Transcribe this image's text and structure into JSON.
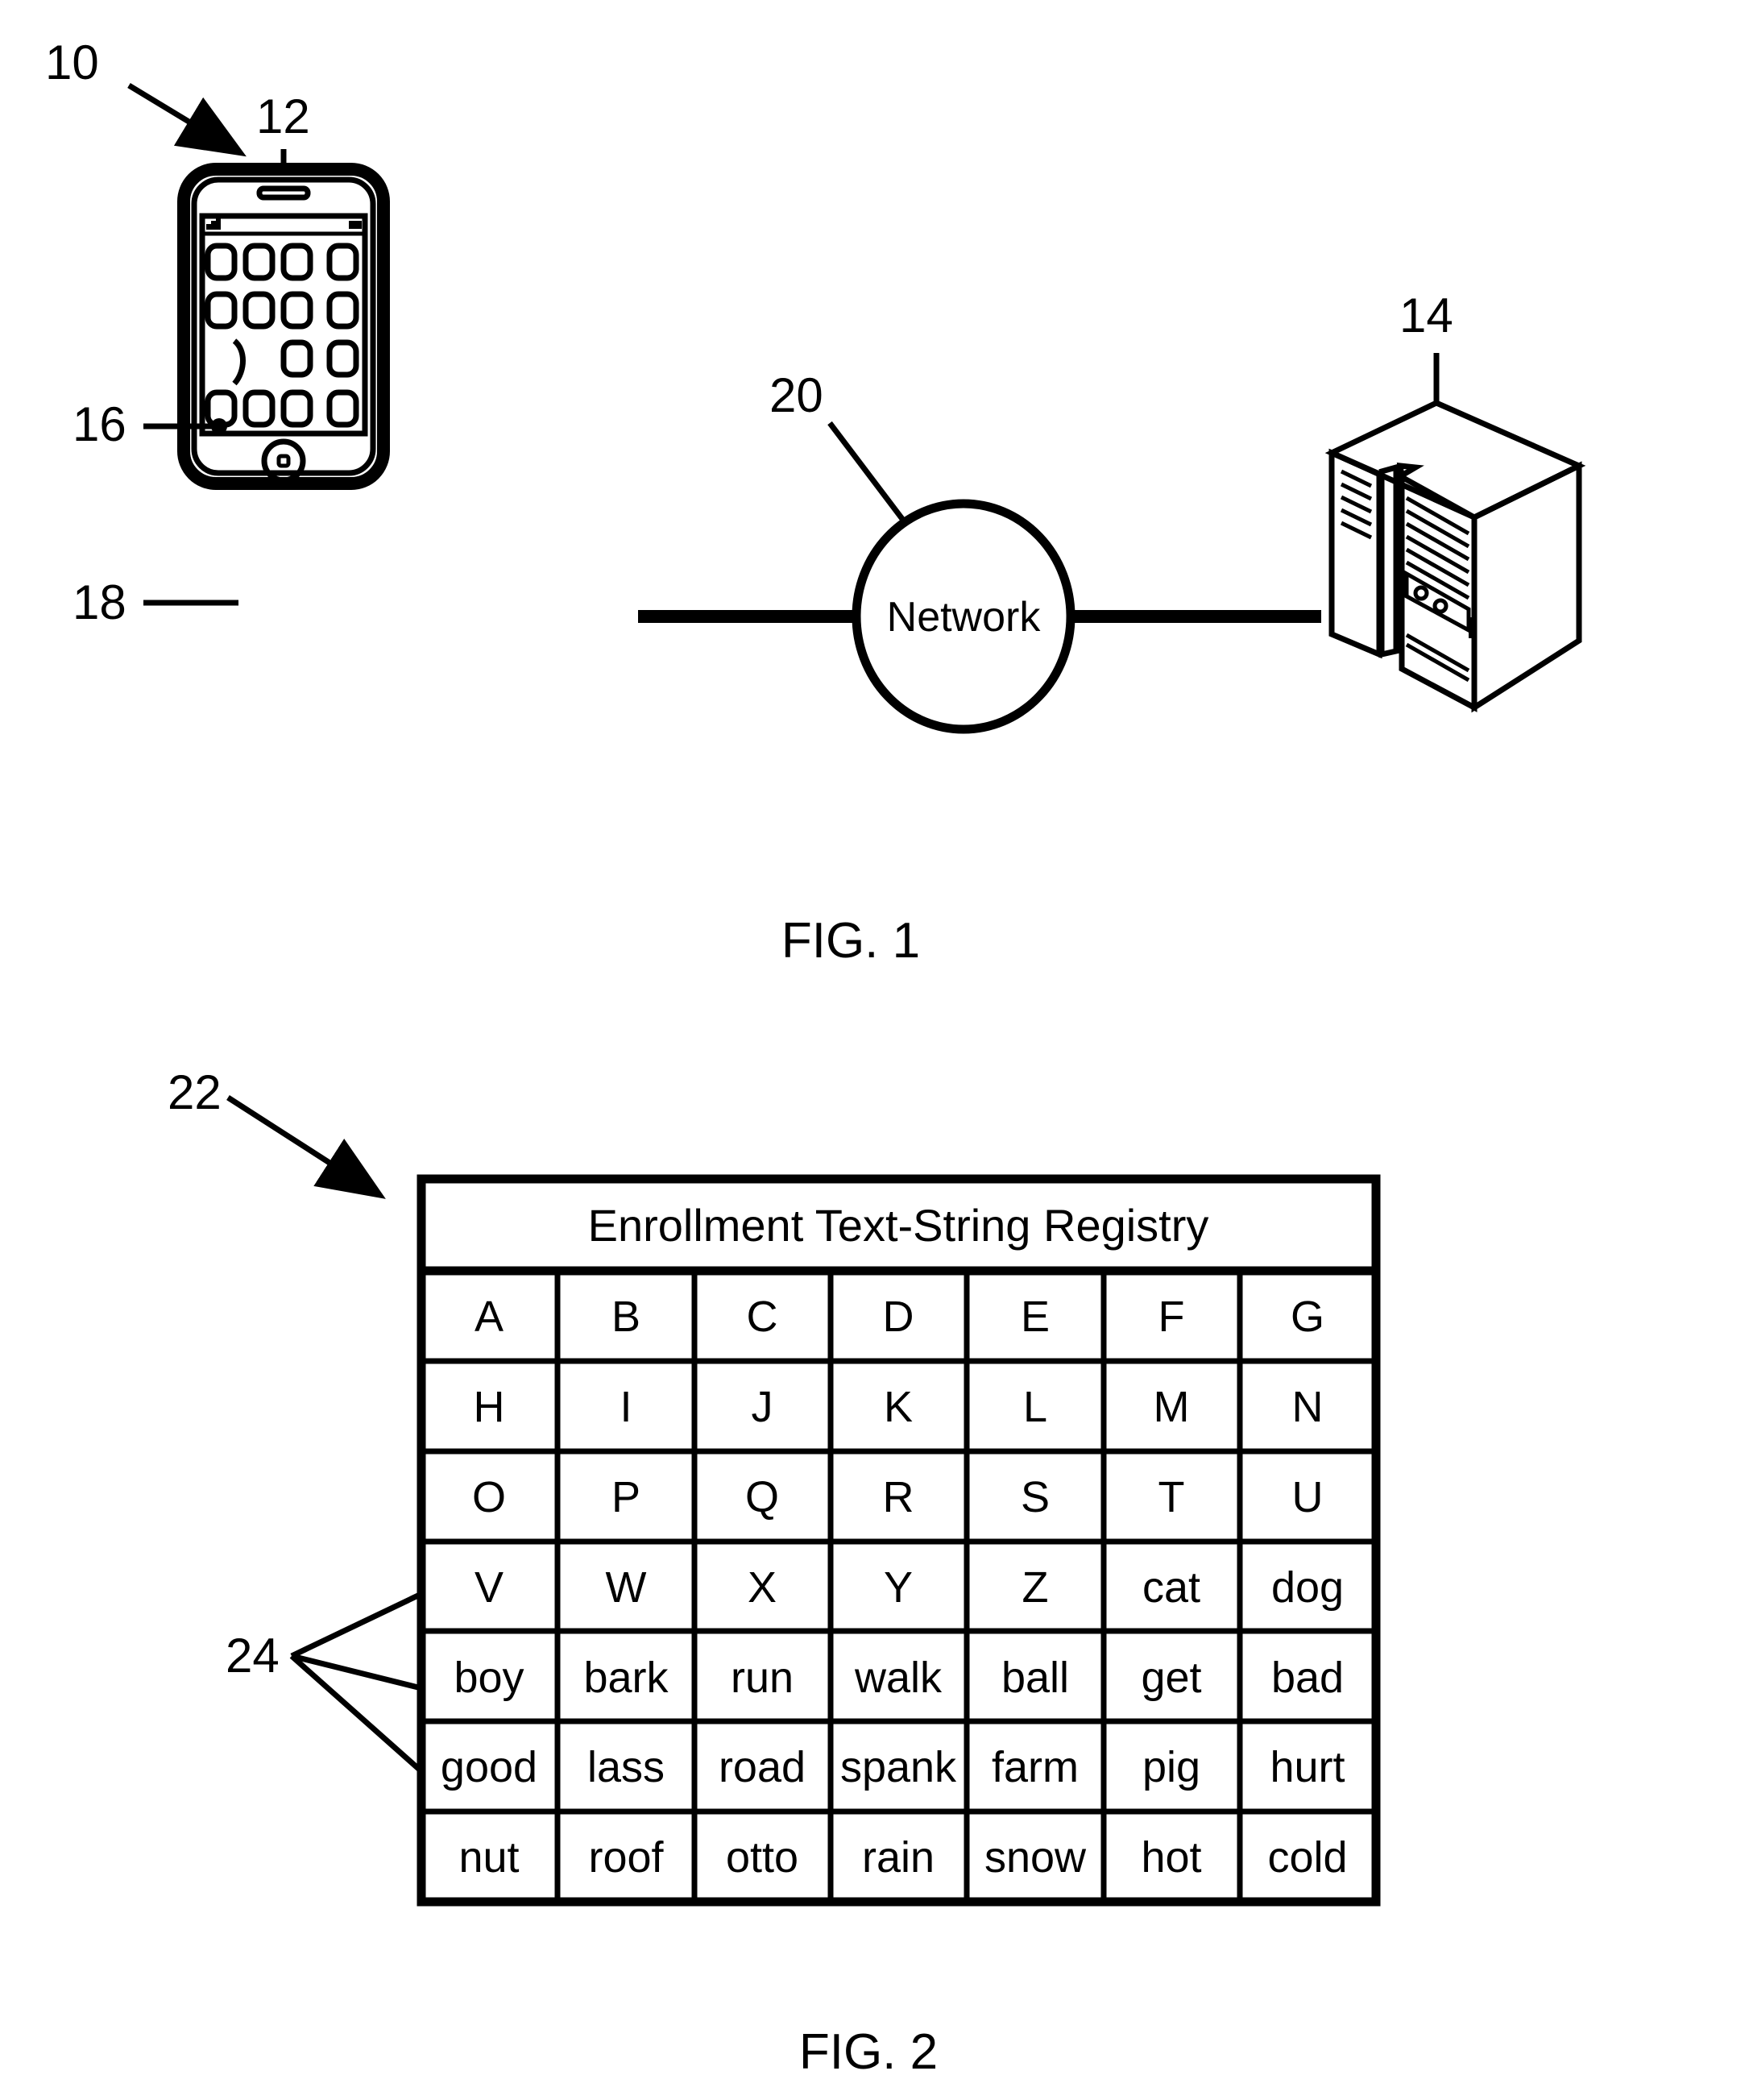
{
  "figure1": {
    "caption": "FIG. 1",
    "reference_numerals": {
      "system": "10",
      "mobile_device": "12",
      "server": "14",
      "app_icon": "16",
      "icon_group": "18",
      "network": "20"
    },
    "network_label": "Network"
  },
  "figure2": {
    "caption": "FIG. 2",
    "reference_numerals": {
      "registry_table": "22",
      "text_string_entries": "24"
    },
    "table": {
      "title": "Enrollment Text-String Registry",
      "columns": 7,
      "rows": [
        [
          "A",
          "B",
          "C",
          "D",
          "E",
          "F",
          "G"
        ],
        [
          "H",
          "I",
          "J",
          "K",
          "L",
          "M",
          "N"
        ],
        [
          "O",
          "P",
          "Q",
          "R",
          "S",
          "T",
          "U"
        ],
        [
          "V",
          "W",
          "X",
          "Y",
          "Z",
          "cat",
          "dog"
        ],
        [
          "boy",
          "bark",
          "run",
          "walk",
          "ball",
          "get",
          "bad"
        ],
        [
          "good",
          "lass",
          "road",
          "spank",
          "farm",
          "pig",
          "hurt"
        ],
        [
          "nut",
          "roof",
          "otto",
          "rain",
          "snow",
          "hot",
          "cold"
        ]
      ]
    }
  },
  "colors": {
    "ink": "#000000",
    "paper": "#ffffff"
  }
}
